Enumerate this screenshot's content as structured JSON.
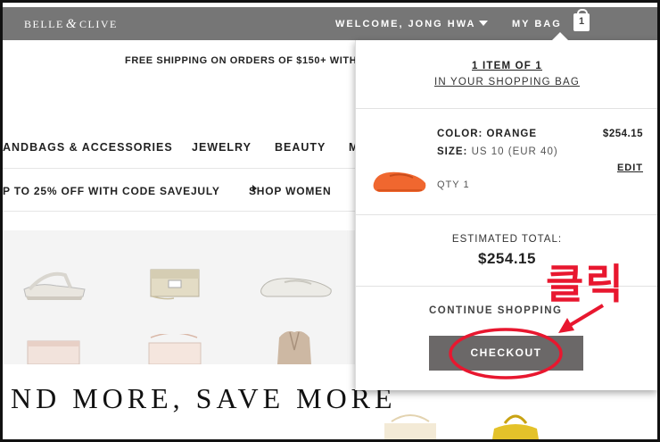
{
  "header": {
    "logo_left": "BELLE",
    "logo_amp": "&",
    "logo_right": "CLIVE",
    "welcome": "WELCOME, JONG HWA",
    "my_bag": "MY BAG",
    "bag_count": "1"
  },
  "promo": "FREE SHIPPING ON ORDERS OF $150+ WITH",
  "nav": {
    "handbags": "ANDBAGS & ACCESSORIES",
    "jewelry": "JEWELRY",
    "beauty": "BEAUTY",
    "more": "M"
  },
  "subnav": {
    "offer": "P TO 25% OFF WITH CODE SAVEJULY",
    "shop_women": "SHOP WOMEN"
  },
  "banner": "ND MORE, SAVE MORE",
  "bag": {
    "count_text": "1 ITEM OF 1",
    "subtitle": "IN YOUR SHOPPING BAG",
    "item": {
      "color_label": "COLOR: ORANGE",
      "size_label": "SIZE:",
      "size_value": "US 10 (EUR 40)",
      "price": "$254.15",
      "edit": "EDIT",
      "qty": "QTY 1"
    },
    "total_label": "ESTIMATED TOTAL:",
    "total_value": "$254.15",
    "continue": "CONTINUE SHOPPING",
    "checkout": "CHECKOUT"
  },
  "annotation": {
    "text": "클릭",
    "color": "#e8172f"
  },
  "colors": {
    "topbar": "#767676",
    "checkout_bg": "#6b6868",
    "shoe": "#f0672f"
  }
}
